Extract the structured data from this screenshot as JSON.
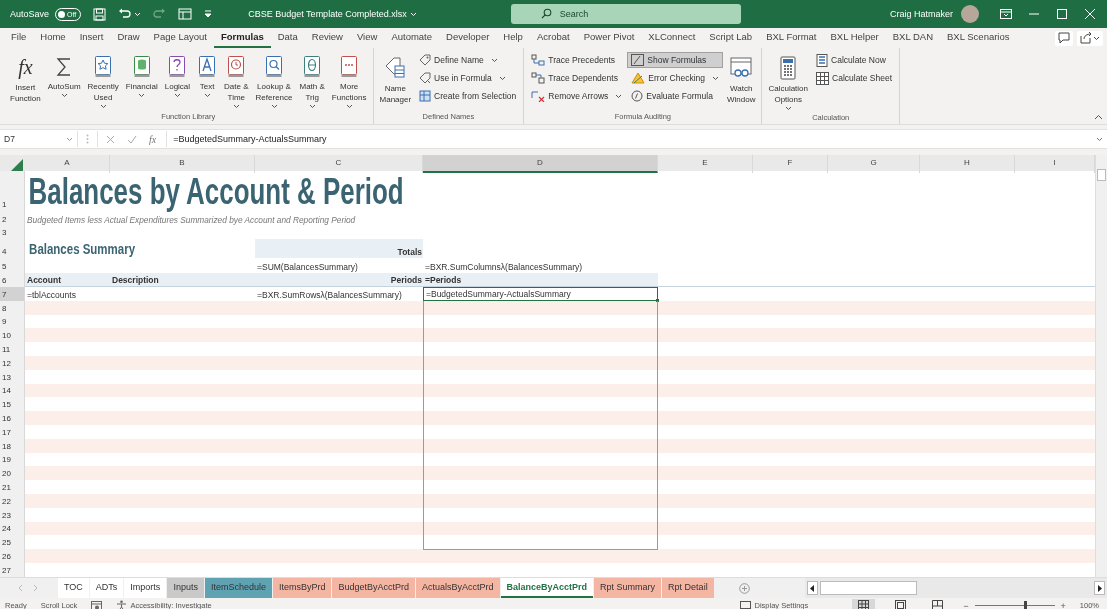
{
  "title_bar": {
    "autosave_label": "AutoSave",
    "autosave": {
      "on": false,
      "label": "Off"
    },
    "filename": "CBSE Budget Template Completed.xlsx",
    "search": {
      "placeholder": "Search"
    },
    "user": "Craig Hatmaker"
  },
  "ribbon_tabs": [
    {
      "label": "File",
      "selected": false
    },
    {
      "label": "Home",
      "selected": false
    },
    {
      "label": "Insert",
      "selected": false
    },
    {
      "label": "Draw",
      "selected": false
    },
    {
      "label": "Page Layout",
      "selected": false
    },
    {
      "label": "Formulas",
      "selected": true
    },
    {
      "label": "Data",
      "selected": false
    },
    {
      "label": "Review",
      "selected": false
    },
    {
      "label": "View",
      "selected": false
    },
    {
      "label": "Automate",
      "selected": false
    },
    {
      "label": "Developer",
      "selected": false
    },
    {
      "label": "Help",
      "selected": false
    },
    {
      "label": "Acrobat",
      "selected": false
    },
    {
      "label": "Power Pivot",
      "selected": false
    },
    {
      "label": "XLConnect",
      "selected": false
    },
    {
      "label": "Script Lab",
      "selected": false
    },
    {
      "label": "BXL Format",
      "selected": false
    },
    {
      "label": "BXL Helper",
      "selected": false
    },
    {
      "label": "BXL DAN",
      "selected": false
    },
    {
      "label": "BXL Scenarios",
      "selected": false
    }
  ],
  "ribbon_groups": [
    {
      "name": "Function Library",
      "items": [
        {
          "kind": "large",
          "label": "Insert\nFunction",
          "glyph": "fx",
          "dropdown": false,
          "on": false
        },
        {
          "kind": "large",
          "label": "AutoSum",
          "dropdown": true,
          "on": false
        },
        {
          "kind": "large",
          "label": "Recently\nUsed",
          "dropdown": true,
          "on": false
        },
        {
          "kind": "large",
          "label": "Financial",
          "dropdown": true,
          "on": false
        },
        {
          "kind": "large",
          "label": "Logical",
          "dropdown": true,
          "on": false
        },
        {
          "kind": "large",
          "label": "Text",
          "dropdown": true,
          "on": false
        },
        {
          "kind": "large",
          "label": "Date &\nTime",
          "dropdown": true,
          "on": false
        },
        {
          "kind": "large",
          "label": "Lookup &\nReference",
          "dropdown": true,
          "on": false
        },
        {
          "kind": "large",
          "label": "Math &\nTrig",
          "dropdown": true,
          "on": false
        },
        {
          "kind": "large",
          "label": "More\nFunctions",
          "dropdown": true,
          "on": false
        }
      ]
    },
    {
      "name": "Defined Names",
      "items": [
        {
          "kind": "large",
          "label": "Name\nManager",
          "dropdown": false,
          "on": false
        },
        {
          "kind": "small",
          "label": "Define Name",
          "dropdown": true,
          "on": false
        },
        {
          "kind": "small",
          "label": "Use in Formula",
          "dropdown": true,
          "on": false
        },
        {
          "kind": "small",
          "label": "Create from Selection",
          "dropdown": false,
          "on": false
        }
      ]
    },
    {
      "name": "Formula Auditing",
      "items": [
        {
          "kind": "small",
          "label": "Trace Precedents",
          "dropdown": false,
          "on": false
        },
        {
          "kind": "small",
          "label": "Trace Dependents",
          "dropdown": false,
          "on": false
        },
        {
          "kind": "small",
          "label": "Remove Arrows",
          "dropdown": true,
          "on": false
        },
        {
          "kind": "small",
          "label": "Show Formulas",
          "dropdown": false,
          "on": true
        },
        {
          "kind": "small",
          "label": "Error Checking",
          "dropdown": true,
          "on": false
        },
        {
          "kind": "small",
          "label": "Evaluate Formula",
          "dropdown": false,
          "on": false
        },
        {
          "kind": "large",
          "label": "Watch\nWindow",
          "dropdown": false,
          "on": false
        }
      ]
    },
    {
      "name": "Calculation",
      "items": [
        {
          "kind": "large",
          "label": "Calculation\nOptions",
          "dropdown": true,
          "on": false
        },
        {
          "kind": "small",
          "label": "Calculate Now",
          "dropdown": false,
          "on": false
        },
        {
          "kind": "small",
          "label": "Calculate Sheet",
          "dropdown": false,
          "on": false
        }
      ]
    }
  ],
  "formula_bar": {
    "name_box": "D7",
    "fx_label": "fx",
    "formula": "=BudgetedSummary-ActualsSummary"
  },
  "columns": [
    {
      "label": "A",
      "selected": false
    },
    {
      "label": "B",
      "selected": false
    },
    {
      "label": "C",
      "selected": false
    },
    {
      "label": "D",
      "selected": true
    },
    {
      "label": "E",
      "selected": false
    },
    {
      "label": "F",
      "selected": false
    },
    {
      "label": "G",
      "selected": false
    },
    {
      "label": "H",
      "selected": false
    },
    {
      "label": "I",
      "selected": false
    }
  ],
  "rows": [
    {
      "number": "1",
      "selected": false,
      "cells": [
        {
          "kind": "title",
          "text": "Balances by Account & Period",
          "selected": false
        }
      ]
    },
    {
      "number": "2",
      "selected": false,
      "cells": [
        {
          "kind": "subtitle",
          "text": "Budgeted Items less Actual Expenditures Summarized bye Account and Reporting Period",
          "selected": false
        }
      ]
    },
    {
      "number": "3",
      "selected": false
    },
    {
      "number": "4",
      "selected": false,
      "cells": [
        {
          "kind": "section",
          "text": "Balances Summary",
          "selected": false
        },
        {
          "kind": "empty",
          "selected": false
        },
        {
          "kind": "total_label",
          "text": "Totals",
          "selected": false
        }
      ]
    },
    {
      "number": "5",
      "selected": false,
      "cells": [
        {
          "kind": "empty",
          "selected": false
        },
        {
          "kind": "empty",
          "selected": false
        },
        {
          "kind": "formula",
          "text": "=SUM(BalancesSummary)",
          "selected": false
        },
        {
          "kind": "formula",
          "text": "=BXR.SumColumnsλ(BalancesSummary)",
          "selected": false
        }
      ]
    },
    {
      "number": "6",
      "selected": false,
      "cells": [
        {
          "kind": "header",
          "text": "Account",
          "selected": false
        },
        {
          "kind": "header",
          "text": "Description",
          "selected": false
        },
        {
          "kind": "header_right",
          "text": "Periods",
          "selected": false
        },
        {
          "kind": "header",
          "text": "=Periods",
          "selected": false
        }
      ]
    },
    {
      "number": "7",
      "selected": true,
      "cells": [
        {
          "kind": "formula",
          "text": "=tblAccounts",
          "selected": false
        },
        {
          "kind": "empty",
          "selected": false
        },
        {
          "kind": "formula",
          "text": "=BXR.SumRowsλ(BalancesSummary)",
          "selected": false
        },
        {
          "kind": "formula",
          "text": "=BudgetedSummary-ActualsSummary",
          "selected": true
        }
      ]
    },
    {
      "number": "8",
      "selected": false
    },
    {
      "number": "9",
      "selected": false
    },
    {
      "number": "10",
      "selected": false
    },
    {
      "number": "11",
      "selected": false
    },
    {
      "number": "12",
      "selected": false
    },
    {
      "number": "13",
      "selected": false
    },
    {
      "number": "14",
      "selected": false
    },
    {
      "number": "15",
      "selected": false
    },
    {
      "number": "16",
      "selected": false
    },
    {
      "number": "17",
      "selected": false
    },
    {
      "number": "18",
      "selected": false
    },
    {
      "number": "19",
      "selected": false
    },
    {
      "number": "20",
      "selected": false
    },
    {
      "number": "21",
      "selected": false
    },
    {
      "number": "22",
      "selected": false
    },
    {
      "number": "23",
      "selected": false
    },
    {
      "number": "24",
      "selected": false
    },
    {
      "number": "25",
      "selected": false
    },
    {
      "number": "26",
      "selected": false
    },
    {
      "number": "27",
      "selected": false
    }
  ],
  "sheet_tabs": [
    {
      "label": "TOC",
      "color": "#ffffff",
      "selected": false
    },
    {
      "label": "ADTs",
      "color": "#ffffff",
      "selected": false
    },
    {
      "label": "Imports",
      "color": "#ffffff",
      "selected": false
    },
    {
      "label": "Inputs",
      "color": "#c9c9c9",
      "selected": false
    },
    {
      "label": "ItemSchedule",
      "color": "#5fa3b3",
      "selected": false
    },
    {
      "label": "ItemsByPrd",
      "color": "#f4b5a3",
      "selected": false
    },
    {
      "label": "BudgetByAcctPrd",
      "color": "#f4b5a3",
      "selected": false
    },
    {
      "label": "ActualsByAcctPrd",
      "color": "#f4b5a3",
      "selected": false
    },
    {
      "label": "BalanceByAcctPrd",
      "color": "#ffffff",
      "selected": true
    },
    {
      "label": "Rpt Summary",
      "color": "#f4b5a3",
      "selected": false
    },
    {
      "label": "Rpt Detail",
      "color": "#f4b5a3",
      "selected": false
    }
  ],
  "status_bar": {
    "items": [
      "Ready",
      "Scroll Lock"
    ],
    "accessibility": "Accessibility: Investigate",
    "display_settings": "Display Settings",
    "views": [
      {
        "kind": "normal",
        "selected": true
      },
      {
        "kind": "page_layout",
        "selected": false
      },
      {
        "kind": "page_break",
        "selected": false
      }
    ],
    "zoom": {
      "minus": "−",
      "plus": "+",
      "level": 0.62,
      "reading": "100%"
    }
  }
}
